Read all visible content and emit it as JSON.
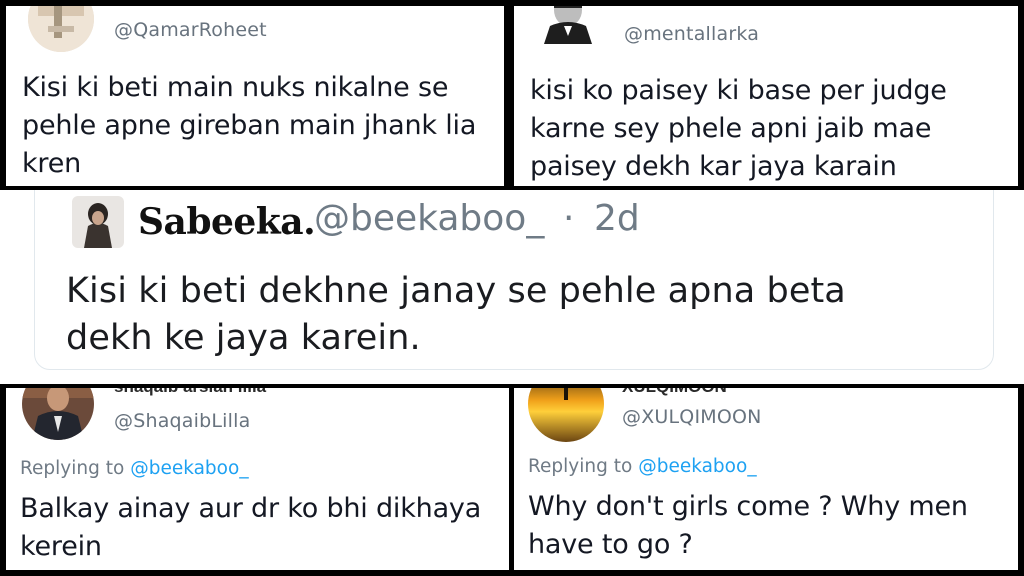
{
  "top_left": {
    "handle": "@QamarRoheet",
    "text_lines": [
      "Kisi ki beti main nuks nikalne se",
      "pehle apne gireban main jhank lia",
      "kren"
    ]
  },
  "top_right": {
    "handle": "@mentallarka",
    "text_lines": [
      "kisi ko paisey ki base per judge",
      "karne sey phele apni jaib mae",
      "paisey  dekh kar jaya karain"
    ]
  },
  "center": {
    "name": "Sabeeka.",
    "handle": "@beekaboo_",
    "separator": "·",
    "time": "2d",
    "text_lines": [
      "Kisi ki beti dekhne janay se pehle apna beta",
      "dekh ke jaya karein."
    ]
  },
  "bottom_left": {
    "cut_name": "shaqaib arslan lilla",
    "handle": "@ShaqaibLilla",
    "replying_prefix": "Replying to",
    "replying_mention": "@beekaboo_",
    "text_lines": [
      "Balkay ainay aur dr ko bhi dikhaya",
      "kerein"
    ]
  },
  "bottom_right": {
    "cut_name": "XULQIMOON",
    "handle": "@XULQIMOON",
    "replying_prefix": "Replying to",
    "replying_mention": "@beekaboo_",
    "text_lines": [
      "Why don't girls come ? Why men",
      "have to go ?"
    ]
  },
  "colors": {
    "border": "#000000",
    "mention": "#1da1f2",
    "muted_text": "#68737e",
    "body_text": "#141823"
  }
}
